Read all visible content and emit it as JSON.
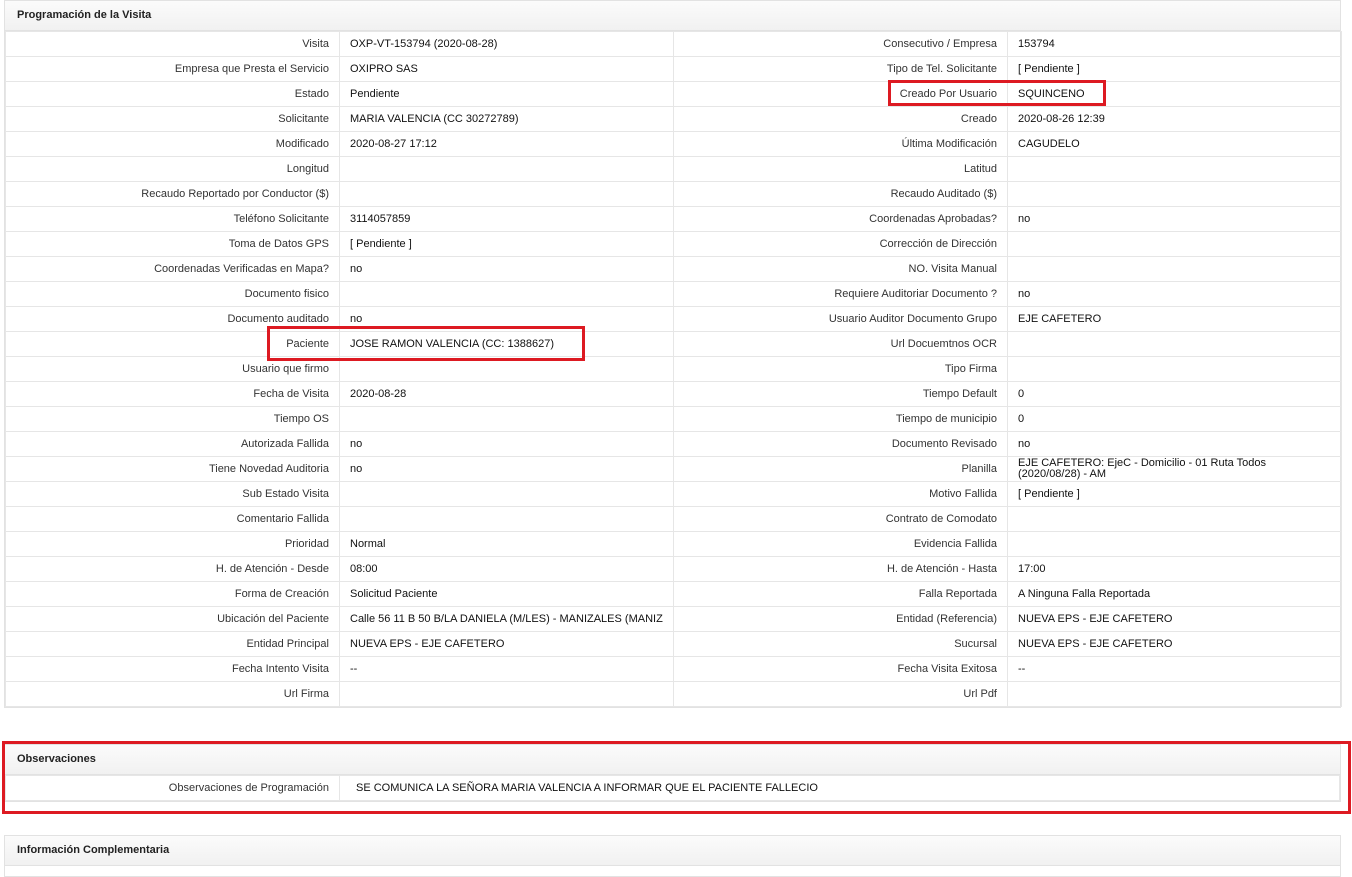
{
  "section1": {
    "title": "Programación de la Visita",
    "rows": [
      [
        "Visita",
        "OXP-VT-153794 (2020-08-28)",
        "Consecutivo / Empresa",
        "153794"
      ],
      [
        "Empresa que Presta el Servicio",
        "OXIPRO SAS",
        "Tipo de Tel. Solicitante",
        "[ Pendiente ]"
      ],
      [
        "Estado",
        "Pendiente",
        "Creado Por Usuario",
        "SQUINCENO"
      ],
      [
        "Solicitante",
        "MARIA VALENCIA (CC 30272789)",
        "Creado",
        "2020-08-26 12:39"
      ],
      [
        "Modificado",
        "2020-08-27 17:12",
        "Última Modificación",
        " CAGUDELO"
      ],
      [
        "Longitud",
        "",
        "Latitud",
        ""
      ],
      [
        "Recaudo Reportado por Conductor ($)",
        "",
        "Recaudo Auditado ($)",
        ""
      ],
      [
        "Teléfono Solicitante",
        "3114057859",
        "Coordenadas Aprobadas?",
        " no"
      ],
      [
        "Toma de Datos GPS",
        "[ Pendiente ]",
        "Corrección de Dirección",
        ""
      ],
      [
        "Coordenadas Verificadas en Mapa?",
        " no",
        "NO. Visita Manual",
        ""
      ],
      [
        "Documento fisico",
        "",
        "Requiere Auditoriar Documento ?",
        " no"
      ],
      [
        "Documento auditado",
        " no",
        "Usuario Auditor Documento Grupo",
        "EJE CAFETERO"
      ],
      [
        "Paciente",
        "JOSE RAMON VALENCIA (CC: 1388627)",
        "Url Docuemtnos OCR",
        ""
      ],
      [
        "Usuario que firmo",
        "",
        "Tipo Firma",
        ""
      ],
      [
        "Fecha de Visita",
        " 2020-08-28",
        "Tiempo Default",
        "0"
      ],
      [
        "Tiempo OS",
        "",
        "Tiempo de municipio",
        "0"
      ],
      [
        "Autorizada Fallida",
        " no",
        "Documento Revisado",
        " no"
      ],
      [
        "Tiene Novedad Auditoria",
        " no",
        "Planilla",
        "EJE CAFETERO: EjeC - Domicilio - 01 Ruta Todos (2020/08/28) - AM"
      ],
      [
        "Sub Estado Visita",
        "",
        "Motivo Fallida",
        "[ Pendiente ]"
      ],
      [
        "Comentario Fallida",
        "",
        "Contrato de Comodato",
        ""
      ],
      [
        "Prioridad",
        "Normal",
        "Evidencia Fallida",
        ""
      ],
      [
        "H. de Atención - Desde",
        "08:00",
        "H. de Atención - Hasta",
        "17:00"
      ],
      [
        "Forma de Creación",
        "Solicitud Paciente",
        "Falla Reportada",
        "A Ninguna Falla Reportada"
      ],
      [
        "Ubicación del Paciente",
        "Calle 56 11 B 50 B/LA DANIELA (M/LES) - MANIZALES (MANIZ",
        "Entidad (Referencia)",
        "NUEVA EPS - EJE CAFETERO"
      ],
      [
        "Entidad Principal",
        "NUEVA EPS - EJE CAFETERO",
        "Sucursal",
        "NUEVA EPS - EJE CAFETERO"
      ],
      [
        "Fecha Intento Visita",
        " --",
        "Fecha Visita Exitosa",
        " --"
      ],
      [
        "Url Firma",
        "",
        "Url Pdf",
        ""
      ]
    ]
  },
  "section2": {
    "title": "Observaciones",
    "label": "Observaciones de Programación",
    "value": "SE COMUNICA LA SEÑORA MARIA VALENCIA A INFORMAR QUE EL PACIENTE FALLECIO"
  },
  "section3": {
    "title": "Información Complementaria"
  },
  "colors": {
    "highlight": "#dd1a22",
    "border": "#e2e2e2"
  }
}
